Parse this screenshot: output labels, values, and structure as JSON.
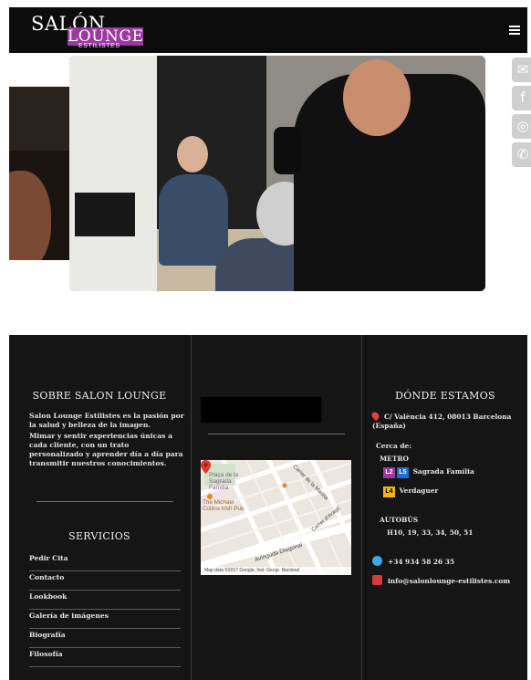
{
  "header": {
    "logo": {
      "line1": "SALÓN",
      "line2": "LOUNGE",
      "line3": "ESTILISTES"
    },
    "menu_icon": "hamburger-menu-icon"
  },
  "hero": {
    "side_icons": [
      "mail-icon",
      "facebook-icon",
      "instagram-icon",
      "phone-icon"
    ],
    "side_glyphs": [
      "✉",
      "f",
      "◎",
      "✆"
    ]
  },
  "footer": {
    "about": {
      "title": "SOBRE SALON LOUNGE",
      "paragraph1": "Salon Lounge Estilistes es la pasión por la salud y belleza de la imagen.",
      "paragraph2": "Mimar y sentir experiencias únicas a cada cliente, con un trato personalizado y aprender día a día para transmitir nuestros conocimientos."
    },
    "services": {
      "title": "SERVICIOS",
      "items": [
        "Pedir Cita",
        "Contacto",
        "Lookbook",
        "Galería de imágenes",
        "Biografía",
        "Filosofía"
      ]
    },
    "map": {
      "labels": {
        "plaza": "Plaça de la Sagrada Família",
        "pub": "The Michael Collins Irish Pub",
        "street1": "Carrer de la Marina",
        "street2": "Avinguda Diagonal",
        "street3": "Carrer d'Aragó"
      },
      "credit": "Map data ©2017 Google, Inst. Geogr. Nacional"
    },
    "where": {
      "title": "DÓNDE ESTAMOS",
      "address": "C/ València 412, 08013 Barcelona (España)",
      "near_label": "Cerca de:",
      "metro_label": "METRO",
      "metro_lines_1": [
        "L2",
        "L5"
      ],
      "metro_station_1": "Sagrada Família",
      "metro_lines_2": [
        "L4"
      ],
      "metro_station_2": "Verdaguer",
      "bus_label": "AUTOBÚS",
      "bus_lines": "H10, 19, 33, 34, 50, 51",
      "phone": "+34 934 58 26 35",
      "email": "info@salonlounge-estilistes.com"
    }
  }
}
